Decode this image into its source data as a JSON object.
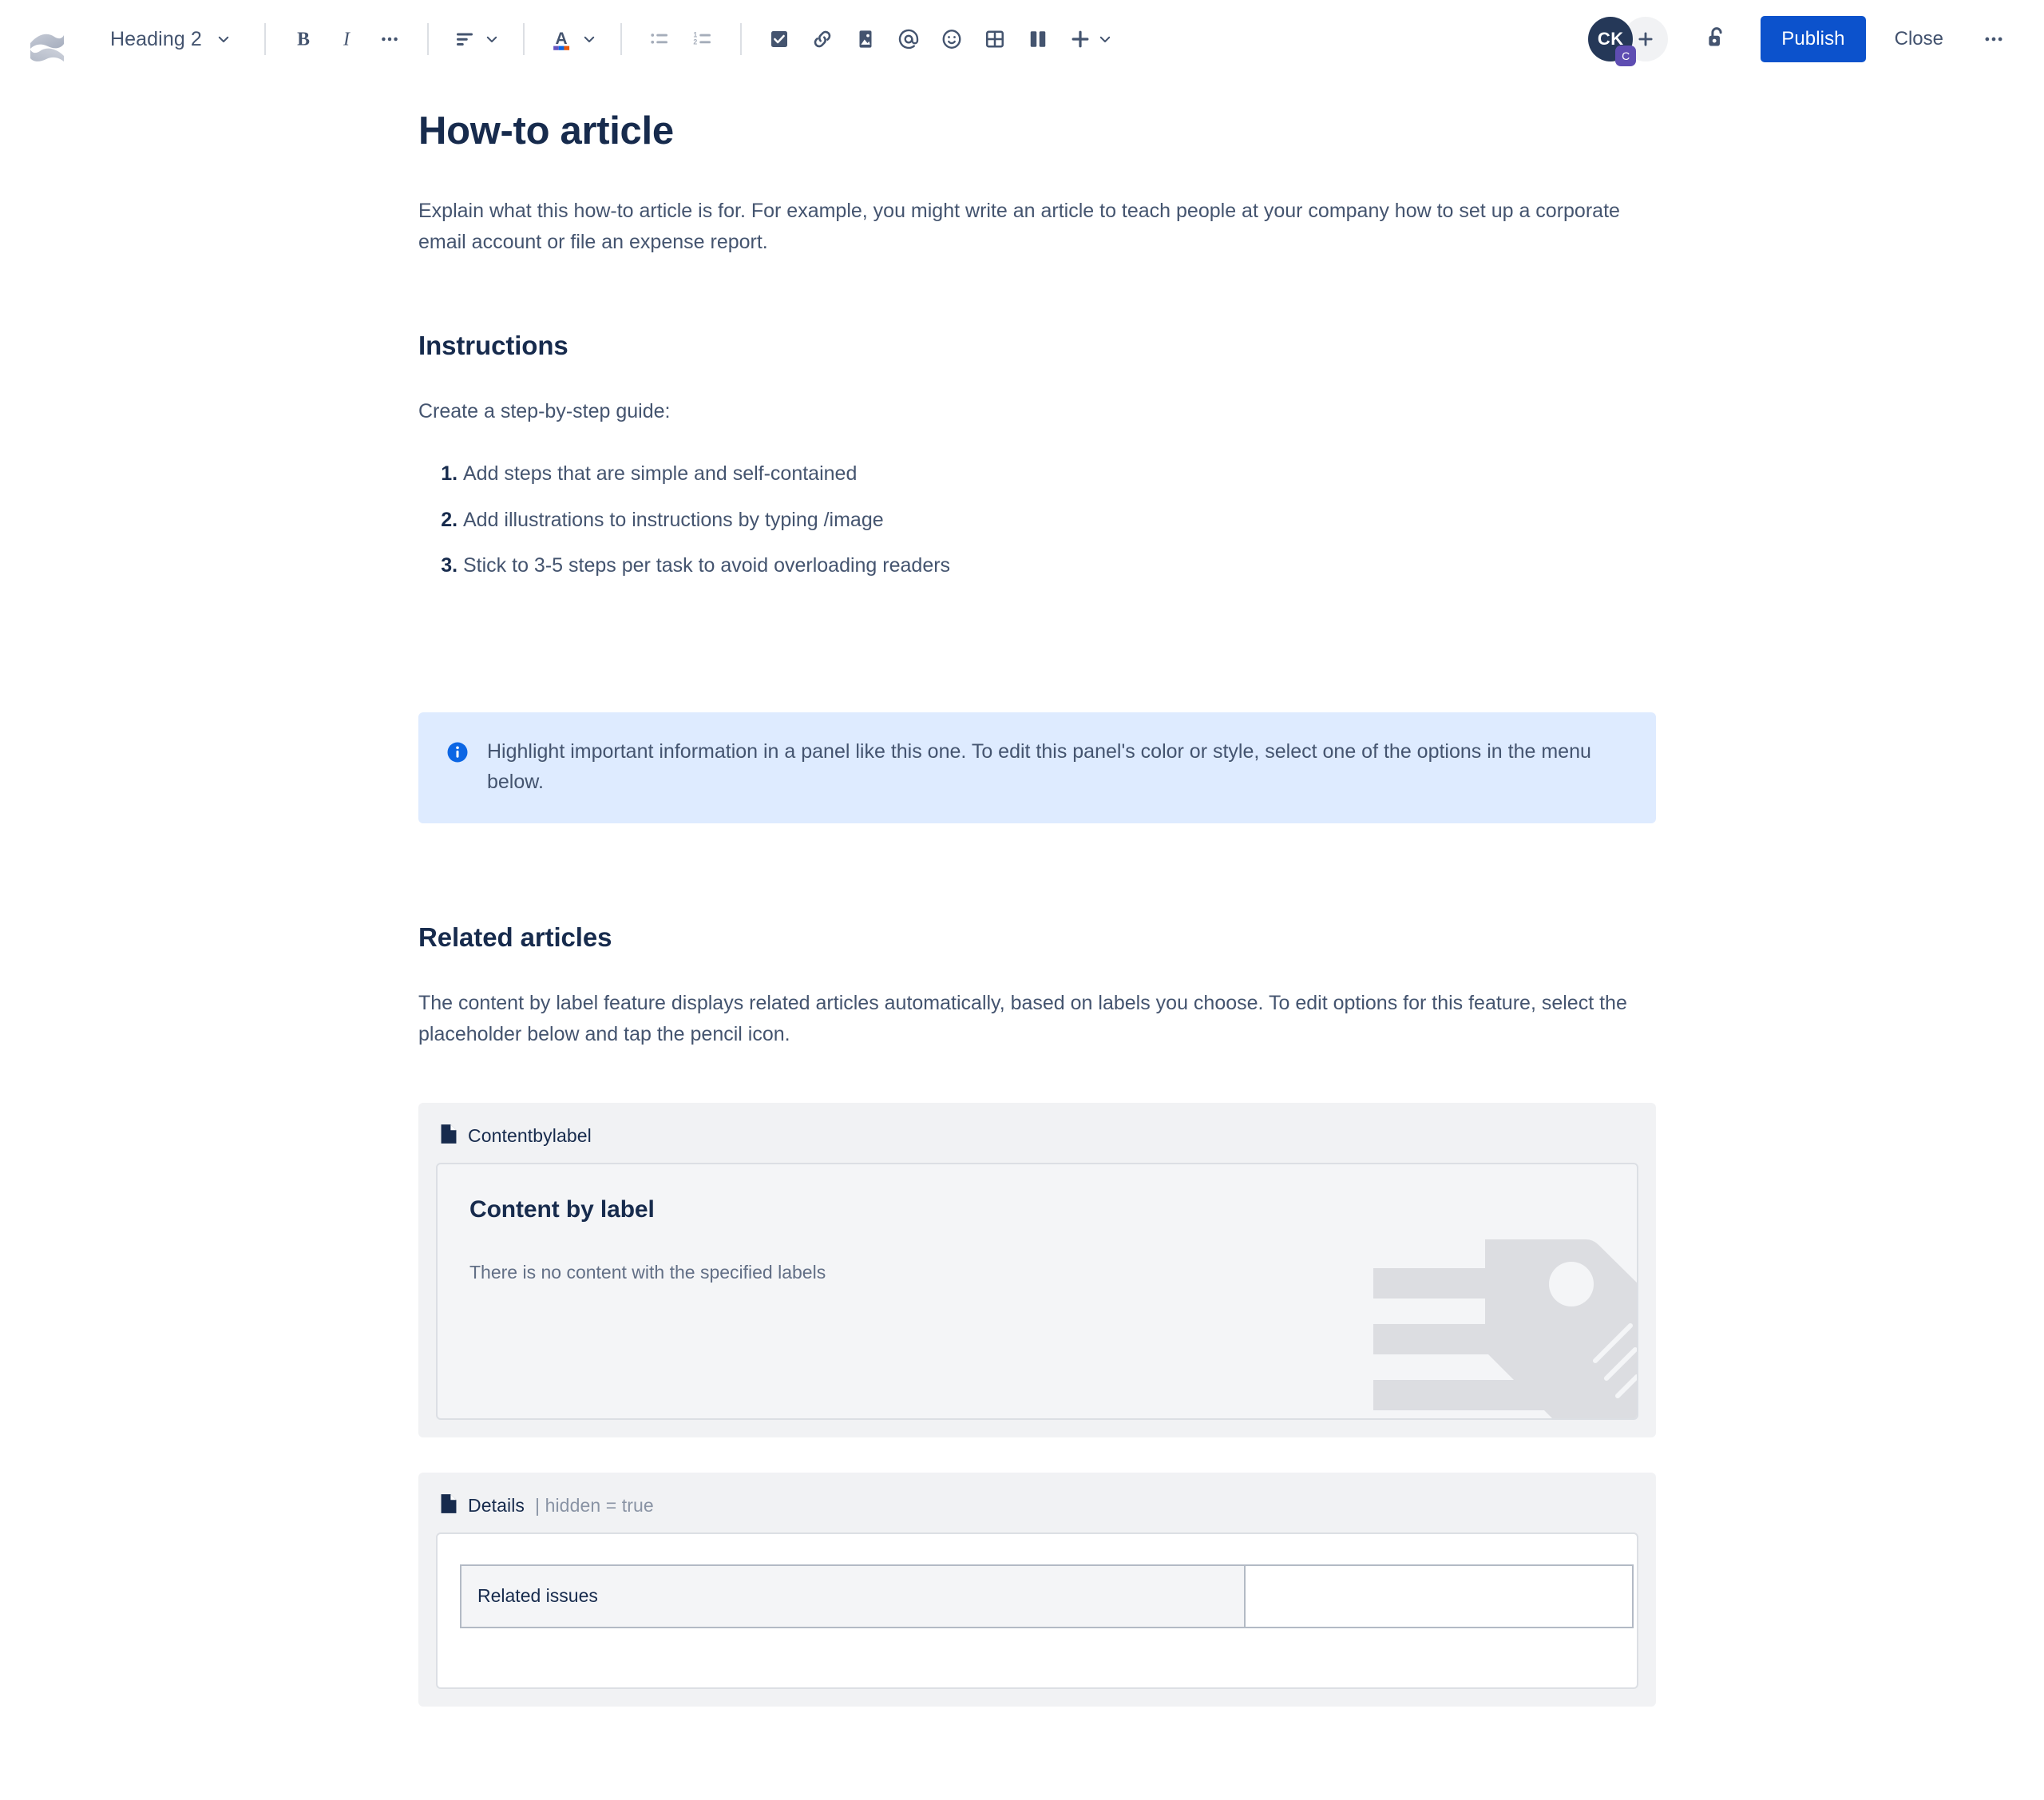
{
  "toolbar": {
    "logo_name": "confluence-logo",
    "block_type": "Heading 2",
    "buttons": {
      "bold": "B",
      "italic": "I",
      "more_formatting": "•••",
      "text_align": "align",
      "text_color": "A",
      "bullet_list": "bullet list",
      "numbered_list": "numbered list",
      "action_item": "action item",
      "link": "link",
      "image": "image",
      "mention": "mention",
      "emoji": "emoji",
      "table": "table",
      "layout": "layout",
      "insert": "insert"
    },
    "avatar": {
      "initials": "CK",
      "badge": "C",
      "add_label": "+"
    },
    "restrictions_label": "restrictions",
    "publish_label": "Publish",
    "close_label": "Close",
    "more_label": "•••",
    "colors": {
      "publish_bg": "#0c52cc",
      "avatar_bg": "#253858",
      "badge_bg": "#5e4db2"
    }
  },
  "document": {
    "title": "How-to article",
    "intro": "Explain what this how-to article is for. For example, you might write an article to teach people at your company how to set up a corporate email account or file an expense report.",
    "instructions": {
      "heading": "Instructions",
      "lead": "Create a step-by-step guide:",
      "steps": [
        "Add steps that are simple and self-contained",
        "Add illustrations to instructions by typing /image",
        "Stick to 3-5 steps per task to avoid overloading readers"
      ]
    },
    "info_panel": {
      "icon": "info-icon",
      "text": "Highlight important information in a panel like this one. To edit this panel's color or style, select one of the options in the menu below.",
      "bg_color": "#deebff",
      "icon_color": "#0c66e4"
    },
    "related_articles": {
      "heading": "Related articles",
      "description": "The content by label feature displays related articles automatically, based on labels you choose. To edit options for this feature, select the placeholder below and tap the pencil icon."
    },
    "contentbylabel_macro": {
      "macro_name": "Contentbylabel",
      "card_title": "Content by label",
      "empty_message": "There is no content with the specified labels"
    },
    "details_macro": {
      "macro_name": "Details",
      "macro_param": "| hidden = true",
      "table": {
        "rows": [
          {
            "header": "Related issues",
            "value": ""
          }
        ]
      }
    }
  }
}
